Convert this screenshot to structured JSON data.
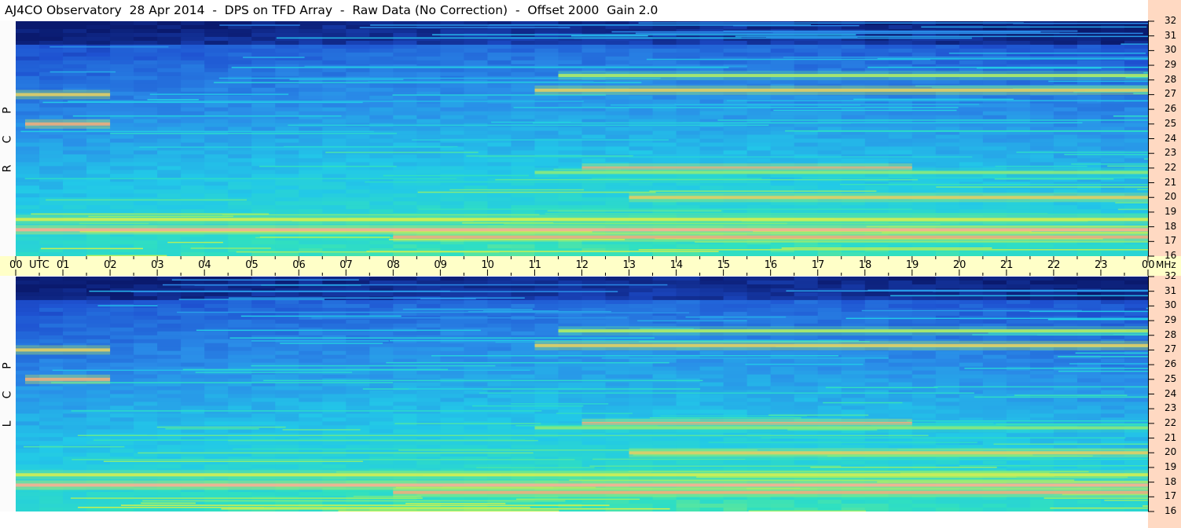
{
  "title": "AJ4CO Observatory  28 Apr 2014  -  DPS on TFD Array  -  Raw Data (No Correction)  -  Offset 2000  Gain 2.0",
  "chart_data": [
    {
      "type": "heatmap",
      "panel": "upper",
      "polarization_label": [
        "R",
        "C",
        "P"
      ],
      "x_ticks": [
        "00",
        "01",
        "02",
        "03",
        "04",
        "05",
        "06",
        "07",
        "08",
        "09",
        "10",
        "11",
        "12",
        "13",
        "14",
        "15",
        "16",
        "17",
        "18",
        "19",
        "20",
        "21",
        "22",
        "23",
        "00"
      ],
      "x_unit": "UTC",
      "y_ticks": [
        32,
        31,
        30,
        29,
        28,
        27,
        26,
        25,
        24,
        23,
        22,
        21,
        20,
        19,
        18,
        17,
        16
      ],
      "y_unit": "MHz",
      "xlim": [
        0,
        24
      ],
      "ylim": [
        16,
        32
      ],
      "colormap": [
        "#0a1a6e",
        "#1e50d0",
        "#2a8ce8",
        "#22c8e8",
        "#30e0c0",
        "#a8f060",
        "#f8f040",
        "#f870b0",
        "#ffffff"
      ],
      "interference_bands": [
        {
          "mhz": 27.0,
          "from_utc": 0.0,
          "to_utc": 2.0,
          "level": 0.8
        },
        {
          "mhz": 27.3,
          "from_utc": 11.0,
          "to_utc": 24.0,
          "level": 0.8
        },
        {
          "mhz": 28.3,
          "from_utc": 11.5,
          "to_utc": 24.0,
          "level": 0.7
        },
        {
          "mhz": 25.0,
          "from_utc": 0.2,
          "to_utc": 2.0,
          "level": 0.85
        },
        {
          "mhz": 22.0,
          "from_utc": 12.0,
          "to_utc": 19.0,
          "level": 0.85
        },
        {
          "mhz": 21.7,
          "from_utc": 11.0,
          "to_utc": 24.0,
          "level": 0.65
        },
        {
          "mhz": 20.0,
          "from_utc": 13.0,
          "to_utc": 24.0,
          "level": 0.8
        },
        {
          "mhz": 18.5,
          "from_utc": 0.0,
          "to_utc": 24.0,
          "level": 0.75
        },
        {
          "mhz": 17.8,
          "from_utc": 0.0,
          "to_utc": 24.0,
          "level": 0.9
        },
        {
          "mhz": 17.3,
          "from_utc": 8.0,
          "to_utc": 24.0,
          "level": 0.85
        }
      ]
    },
    {
      "type": "heatmap",
      "panel": "lower",
      "polarization_label": [
        "L",
        "C",
        "P"
      ],
      "x_ticks": [
        "00",
        "01",
        "02",
        "03",
        "04",
        "05",
        "06",
        "07",
        "08",
        "09",
        "10",
        "11",
        "12",
        "13",
        "14",
        "15",
        "16",
        "17",
        "18",
        "19",
        "20",
        "21",
        "22",
        "23",
        "00"
      ],
      "x_unit": "UTC",
      "y_ticks": [
        32,
        31,
        30,
        29,
        28,
        27,
        26,
        25,
        24,
        23,
        22,
        21,
        20,
        19,
        18,
        17,
        16
      ],
      "y_unit": "MHz",
      "xlim": [
        0,
        24
      ],
      "ylim": [
        16,
        32
      ],
      "colormap": [
        "#0a1a6e",
        "#1e50d0",
        "#2a8ce8",
        "#22c8e8",
        "#30e0c0",
        "#a8f060",
        "#f8f040",
        "#f870b0",
        "#ffffff"
      ],
      "interference_bands": [
        {
          "mhz": 27.0,
          "from_utc": 0.0,
          "to_utc": 2.0,
          "level": 0.8
        },
        {
          "mhz": 27.3,
          "from_utc": 11.0,
          "to_utc": 24.0,
          "level": 0.8
        },
        {
          "mhz": 28.3,
          "from_utc": 11.5,
          "to_utc": 24.0,
          "level": 0.7
        },
        {
          "mhz": 25.0,
          "from_utc": 0.2,
          "to_utc": 2.0,
          "level": 0.85
        },
        {
          "mhz": 22.0,
          "from_utc": 12.0,
          "to_utc": 19.0,
          "level": 0.85
        },
        {
          "mhz": 21.7,
          "from_utc": 11.0,
          "to_utc": 24.0,
          "level": 0.65
        },
        {
          "mhz": 20.0,
          "from_utc": 13.0,
          "to_utc": 24.0,
          "level": 0.8
        },
        {
          "mhz": 18.5,
          "from_utc": 0.0,
          "to_utc": 24.0,
          "level": 0.75
        },
        {
          "mhz": 17.8,
          "from_utc": 0.0,
          "to_utc": 24.0,
          "level": 0.9
        },
        {
          "mhz": 17.3,
          "from_utc": 8.0,
          "to_utc": 24.0,
          "level": 0.85
        }
      ]
    }
  ]
}
